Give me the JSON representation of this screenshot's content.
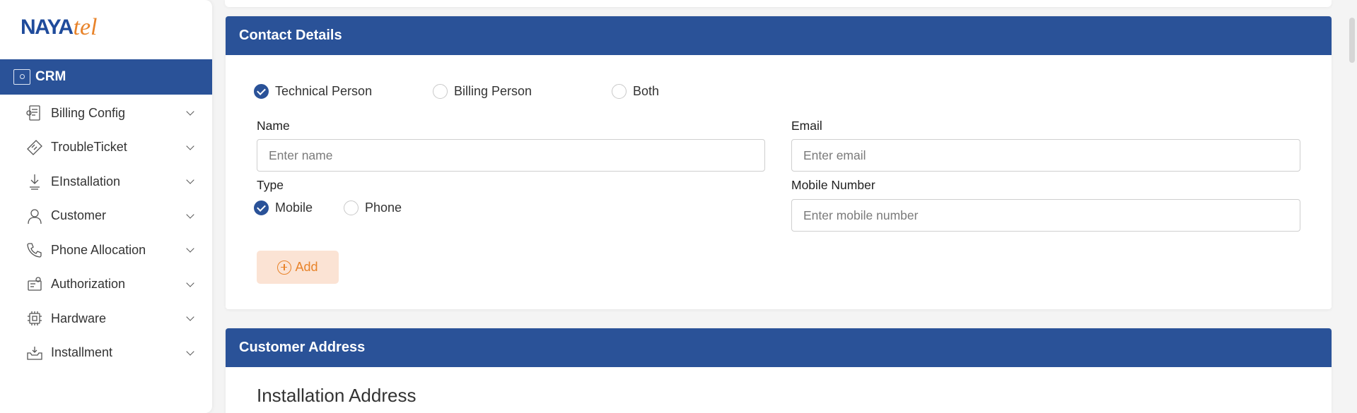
{
  "brand": {
    "part1": "NAYA",
    "part2": "tel"
  },
  "sidebar": {
    "module": "CRM",
    "items": [
      {
        "label": "Billing Config",
        "icon": "billing-icon"
      },
      {
        "label": "TroubleTicket",
        "icon": "ticket-icon"
      },
      {
        "label": "EInstallation",
        "icon": "installation-icon"
      },
      {
        "label": "Customer",
        "icon": "customer-icon"
      },
      {
        "label": "Phone Allocation",
        "icon": "phone-icon"
      },
      {
        "label": "Authorization",
        "icon": "authorization-icon"
      },
      {
        "label": "Hardware",
        "icon": "hardware-icon"
      },
      {
        "label": "Installment",
        "icon": "installment-icon"
      }
    ]
  },
  "contact": {
    "title": "Contact Details",
    "role_options": [
      {
        "label": "Technical Person",
        "checked": true
      },
      {
        "label": "Billing Person",
        "checked": false
      },
      {
        "label": "Both",
        "checked": false
      }
    ],
    "name_label": "Name",
    "name_placeholder": "Enter name",
    "email_label": "Email",
    "email_placeholder": "Enter email",
    "type_label": "Type",
    "type_options": [
      {
        "label": "Mobile",
        "checked": true
      },
      {
        "label": "Phone",
        "checked": false
      }
    ],
    "mobile_label": "Mobile Number",
    "mobile_placeholder": "Enter mobile number",
    "add_label": "Add"
  },
  "address": {
    "title": "Customer Address",
    "subtitle": "Installation Address"
  },
  "colors": {
    "primary": "#2a5298",
    "accent": "#e8832a",
    "add_bg": "#fbe3d4"
  }
}
